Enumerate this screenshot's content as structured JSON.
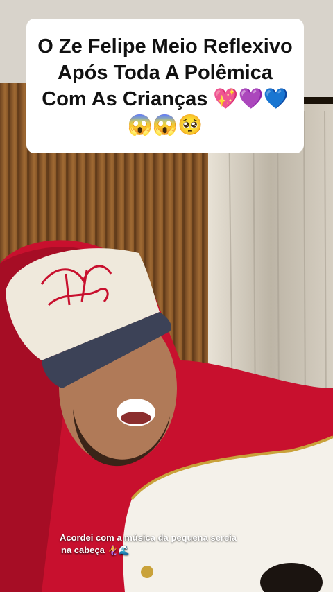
{
  "post": {
    "title": "O Ze Felipe Meio Reflexivo Após Toda A Polêmica Com As Crianças 💖💜💙😱😱🥺",
    "caption_line1": "Acordei com a música da pequena sereia",
    "caption_line2": "na cabeça 🧜‍♀️🌊"
  },
  "media": {
    "description_icon": "video-frame-person-singing-guitar"
  },
  "colors": {
    "card_bg": "#ffffff",
    "hoodie": "#c8102e",
    "wood_wall": "#8a5a2b",
    "curtain": "#cfc8bb"
  }
}
